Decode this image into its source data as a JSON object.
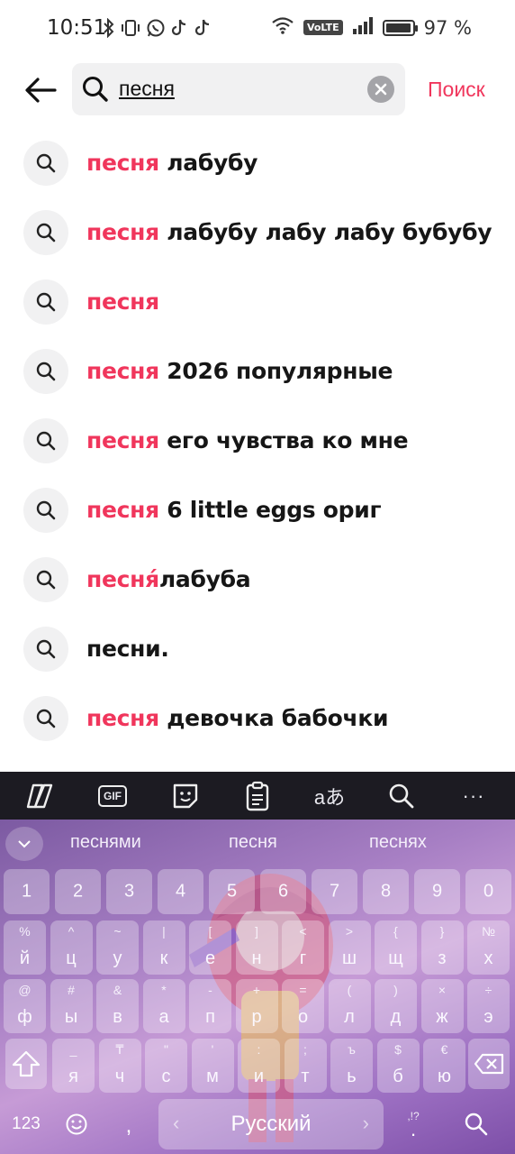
{
  "status_bar": {
    "time": "10:51",
    "battery": "97 %",
    "battery_level": 0.97,
    "network_badge": "VoLTE",
    "icons": [
      "bluetooth-icon",
      "vibrate-icon",
      "whatsapp-icon",
      "tiktok-icon",
      "tiktok-icon",
      "wifi-icon",
      "signal-icon",
      "battery-icon"
    ]
  },
  "header": {
    "search_value": "песня",
    "search_action_label": "Поиск",
    "colors": {
      "accent": "#f0365c",
      "search_bg": "#f1f1f2"
    }
  },
  "suggestions": [
    {
      "highlight": "песня",
      "rest": " лабубу"
    },
    {
      "highlight": "песня",
      "rest": " лабубу лабу лабу бубубу"
    },
    {
      "highlight": "песня",
      "rest": ""
    },
    {
      "highlight": "песня",
      "rest": " 2026 популярные"
    },
    {
      "highlight": "песня",
      "rest": " его чувства ко мне"
    },
    {
      "highlight": "песня",
      "rest": " 6 little eggs ориг"
    },
    {
      "highlight": "песня",
      "rest": "́лабуба"
    },
    {
      "highlight": "",
      "rest": "песни."
    },
    {
      "highlight": "песня",
      "rest": " девочка бабочки"
    }
  ],
  "keyboard": {
    "toolbar": [
      "copilot-icon",
      "gif-icon",
      "sticker-icon",
      "clipboard-icon",
      "translate-icon",
      "search-icon",
      "more-icon"
    ],
    "toolbar_gif": "GIF",
    "toolbar_translate": "aあ",
    "toolbar_more": "···",
    "predictions": [
      "песнями",
      "песня",
      "песнях"
    ],
    "number_row": [
      "1",
      "2",
      "3",
      "4",
      "5",
      "6",
      "7",
      "8",
      "9",
      "0"
    ],
    "row1": [
      {
        "sup": "%",
        "main": "й"
      },
      {
        "sup": "^",
        "main": "ц"
      },
      {
        "sup": "~",
        "main": "у"
      },
      {
        "sup": "|",
        "main": "к"
      },
      {
        "sup": "[",
        "main": "е"
      },
      {
        "sup": "]",
        "main": "н"
      },
      {
        "sup": "<",
        "main": "г"
      },
      {
        "sup": ">",
        "main": "ш"
      },
      {
        "sup": "{",
        "main": "щ"
      },
      {
        "sup": "}",
        "main": "з"
      },
      {
        "sup": "№",
        "main": "х"
      }
    ],
    "row2": [
      {
        "sup": "@",
        "main": "ф"
      },
      {
        "sup": "#",
        "main": "ы"
      },
      {
        "sup": "&",
        "main": "в"
      },
      {
        "sup": "*",
        "main": "а"
      },
      {
        "sup": "-",
        "main": "п"
      },
      {
        "sup": "+",
        "main": "р"
      },
      {
        "sup": "=",
        "main": "о"
      },
      {
        "sup": "(",
        "main": "л"
      },
      {
        "sup": ")",
        "main": "д"
      },
      {
        "sup": "×",
        "main": "ж"
      },
      {
        "sup": "÷",
        "main": "э"
      }
    ],
    "row3": [
      {
        "sup": "_",
        "main": "я"
      },
      {
        "sup": "₸",
        "main": "ч"
      },
      {
        "sup": "\"",
        "main": "с"
      },
      {
        "sup": "'",
        "main": "м"
      },
      {
        "sup": ":",
        "main": "и"
      },
      {
        "sup": ";",
        "main": "т"
      },
      {
        "sup": "ъ",
        "main": "ь"
      },
      {
        "sup": "$",
        "main": "б"
      },
      {
        "sup": "€",
        "main": "ю"
      }
    ],
    "symbols_label": "123",
    "comma": ",",
    "space_label": "Русский",
    "punct_label": ".",
    "punct_sup": ",!?"
  }
}
